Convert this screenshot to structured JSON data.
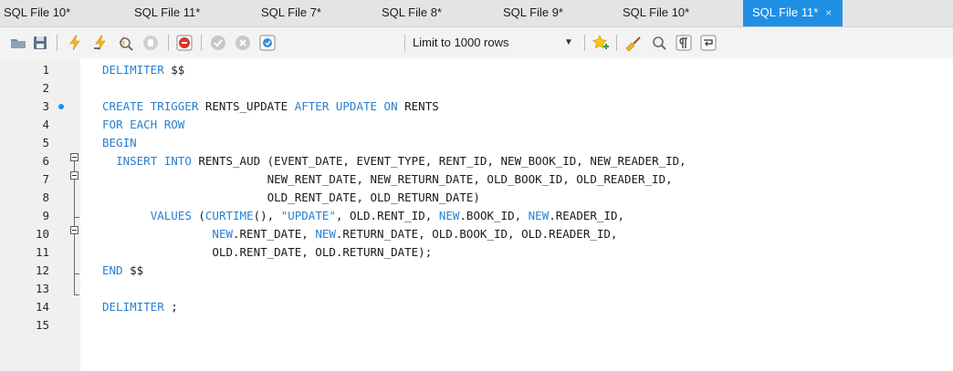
{
  "tabs": [
    {
      "label": "SQL File 10*",
      "active": false
    },
    {
      "label": "SQL File 11*",
      "active": false
    },
    {
      "label": "SQL File 7*",
      "active": false
    },
    {
      "label": "SQL File 8*",
      "active": false
    },
    {
      "label": "SQL File 9*",
      "active": false
    },
    {
      "label": "SQL File 10*",
      "active": false
    },
    {
      "label": "SQL File 11*",
      "active": true
    }
  ],
  "close_glyph": "×",
  "toolbar": {
    "limit_label": "Limit to 1000 rows",
    "icons": [
      "open-folder-icon",
      "save-icon",
      "execute-lightning-icon",
      "execute-cursor-lightning-icon",
      "explain-magnifier-icon",
      "stop-icon",
      "toggle-error-icon",
      "commit-icon",
      "rollback-icon",
      "autocommit-icon",
      "bookmark-star-icon",
      "beautify-broom-icon",
      "find-icon",
      "invisible-chars-icon",
      "wrap-lines-icon"
    ]
  },
  "colors": {
    "accent": "#1f8fe6",
    "keyword": "#2a7fcf"
  },
  "editor": {
    "lines": [
      {
        "n": "1",
        "segs": [
          [
            "kw",
            "DELIMITER"
          ],
          [
            "t",
            " $$"
          ]
        ]
      },
      {
        "n": "2",
        "segs": []
      },
      {
        "n": "3",
        "dot": true,
        "segs": [
          [
            "kw",
            "CREATE TRIGGER"
          ],
          [
            "t",
            " RENTS_UPDATE "
          ],
          [
            "kw",
            "AFTER UPDATE ON"
          ],
          [
            "t",
            " RENTS"
          ]
        ]
      },
      {
        "n": "4",
        "segs": [
          [
            "kw",
            "FOR EACH ROW"
          ]
        ]
      },
      {
        "n": "5",
        "segs": [
          [
            "kw",
            "BEGIN"
          ]
        ]
      },
      {
        "n": "6",
        "segs": [
          [
            "t",
            "  "
          ],
          [
            "kw",
            "INSERT INTO"
          ],
          [
            "t",
            " RENTS_AUD (EVENT_DATE, EVENT_TYPE, RENT_ID, NEW_BOOK_ID, NEW_READER_ID,"
          ]
        ]
      },
      {
        "n": "7",
        "segs": [
          [
            "t",
            "                        NEW_RENT_DATE, NEW_RETURN_DATE, OLD_BOOK_ID, OLD_READER_ID,"
          ]
        ]
      },
      {
        "n": "8",
        "segs": [
          [
            "t",
            "                        OLD_RENT_DATE, OLD_RETURN_DATE)"
          ]
        ]
      },
      {
        "n": "9",
        "segs": [
          [
            "t",
            "       "
          ],
          [
            "kw",
            "VALUES"
          ],
          [
            "t",
            " ("
          ],
          [
            "kw",
            "CURTIME"
          ],
          [
            "t",
            "(), "
          ],
          [
            "str",
            "\"UPDATE\""
          ],
          [
            "t",
            ", OLD.RENT_ID, "
          ],
          [
            "kw",
            "NEW"
          ],
          [
            "t",
            ".BOOK_ID, "
          ],
          [
            "kw",
            "NEW"
          ],
          [
            "t",
            ".READER_ID,"
          ]
        ]
      },
      {
        "n": "10",
        "segs": [
          [
            "t",
            "                "
          ],
          [
            "kw",
            "NEW"
          ],
          [
            "t",
            ".RENT_DATE, "
          ],
          [
            "kw",
            "NEW"
          ],
          [
            "t",
            ".RETURN_DATE, OLD.BOOK_ID, OLD.READER_ID,"
          ]
        ]
      },
      {
        "n": "11",
        "segs": [
          [
            "t",
            "                OLD.RENT_DATE, OLD.RETURN_DATE);"
          ]
        ]
      },
      {
        "n": "12",
        "segs": [
          [
            "kw",
            "END"
          ],
          [
            "t",
            " $$"
          ]
        ]
      },
      {
        "n": "13",
        "segs": []
      },
      {
        "n": "14",
        "segs": [
          [
            "kw",
            "DELIMITER"
          ],
          [
            "t",
            " ;"
          ]
        ]
      },
      {
        "n": "15",
        "segs": []
      }
    ]
  }
}
